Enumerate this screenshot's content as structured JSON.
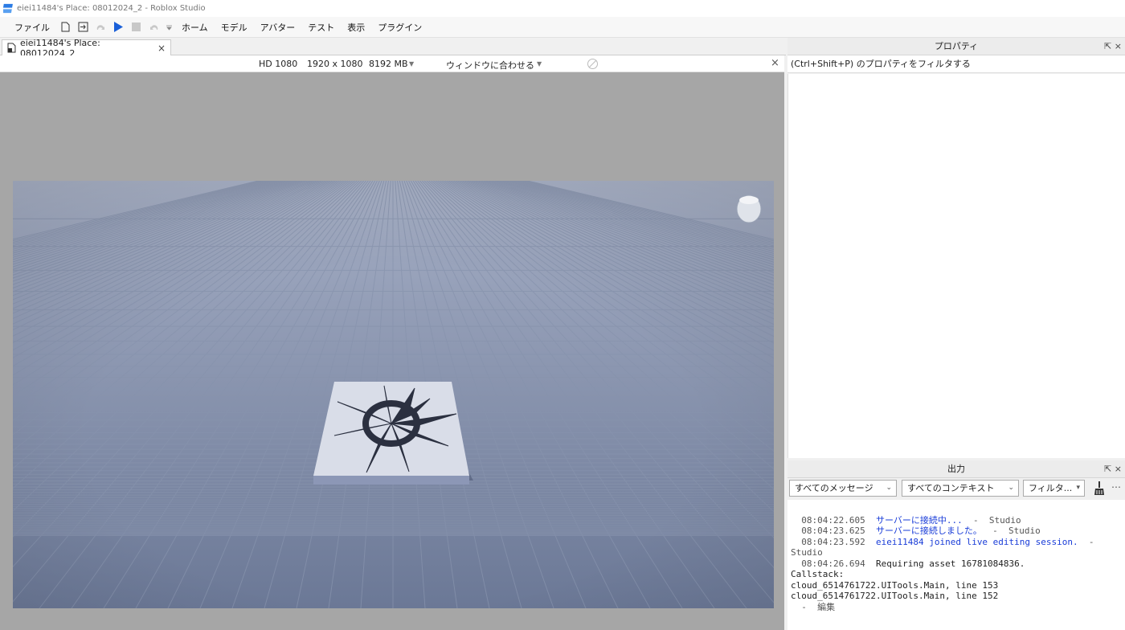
{
  "window": {
    "title": "eiei11484's Place: 08012024_2 - Roblox Studio"
  },
  "menu": {
    "items": [
      "ファイル",
      "ホーム",
      "モデル",
      "アバター",
      "テスト",
      "表示",
      "プラグイン"
    ]
  },
  "doc_tab": {
    "label": "eiei11484's Place: 08012024_2",
    "close": "×"
  },
  "viewport_bar": {
    "preset": "HD 1080",
    "resolution": "1920 x 1080",
    "memory": "8192 MB",
    "fit": "ウィンドウに合わせる",
    "close": "×"
  },
  "properties": {
    "title": "プロパティ",
    "filter_placeholder": "(Ctrl+Shift+P) のプロパティをフィルタする"
  },
  "output": {
    "title": "出力",
    "messages_filter": "すべてのメッセージ",
    "context_filter": "すべてのコンテキスト",
    "text_filter": "フィルタ...",
    "more": "⋯",
    "log": [
      {
        "time": "08:04:22.605",
        "msg": "サーバーに接続中...",
        "src": "-  Studio"
      },
      {
        "time": "08:04:23.625",
        "msg": "サーバーに接続しました。",
        "src": "-  Studio"
      },
      {
        "time": "08:04:23.592",
        "msg": "eiei11484 joined live editing session.",
        "src": "-"
      },
      {
        "text": "Studio"
      },
      {
        "time": "08:04:26.694",
        "msg": "Requiring asset 16781084836."
      },
      {
        "text": "Callstack:"
      },
      {
        "text": "cloud_6514761722.UITools.Main, line 153"
      },
      {
        "text": "cloud_6514761722.UITools.Main, line 152"
      },
      {
        "text": "  -  編集"
      }
    ]
  },
  "colors": {
    "accent": "#1a5fd8",
    "log_blue": "#1a3dd8"
  }
}
